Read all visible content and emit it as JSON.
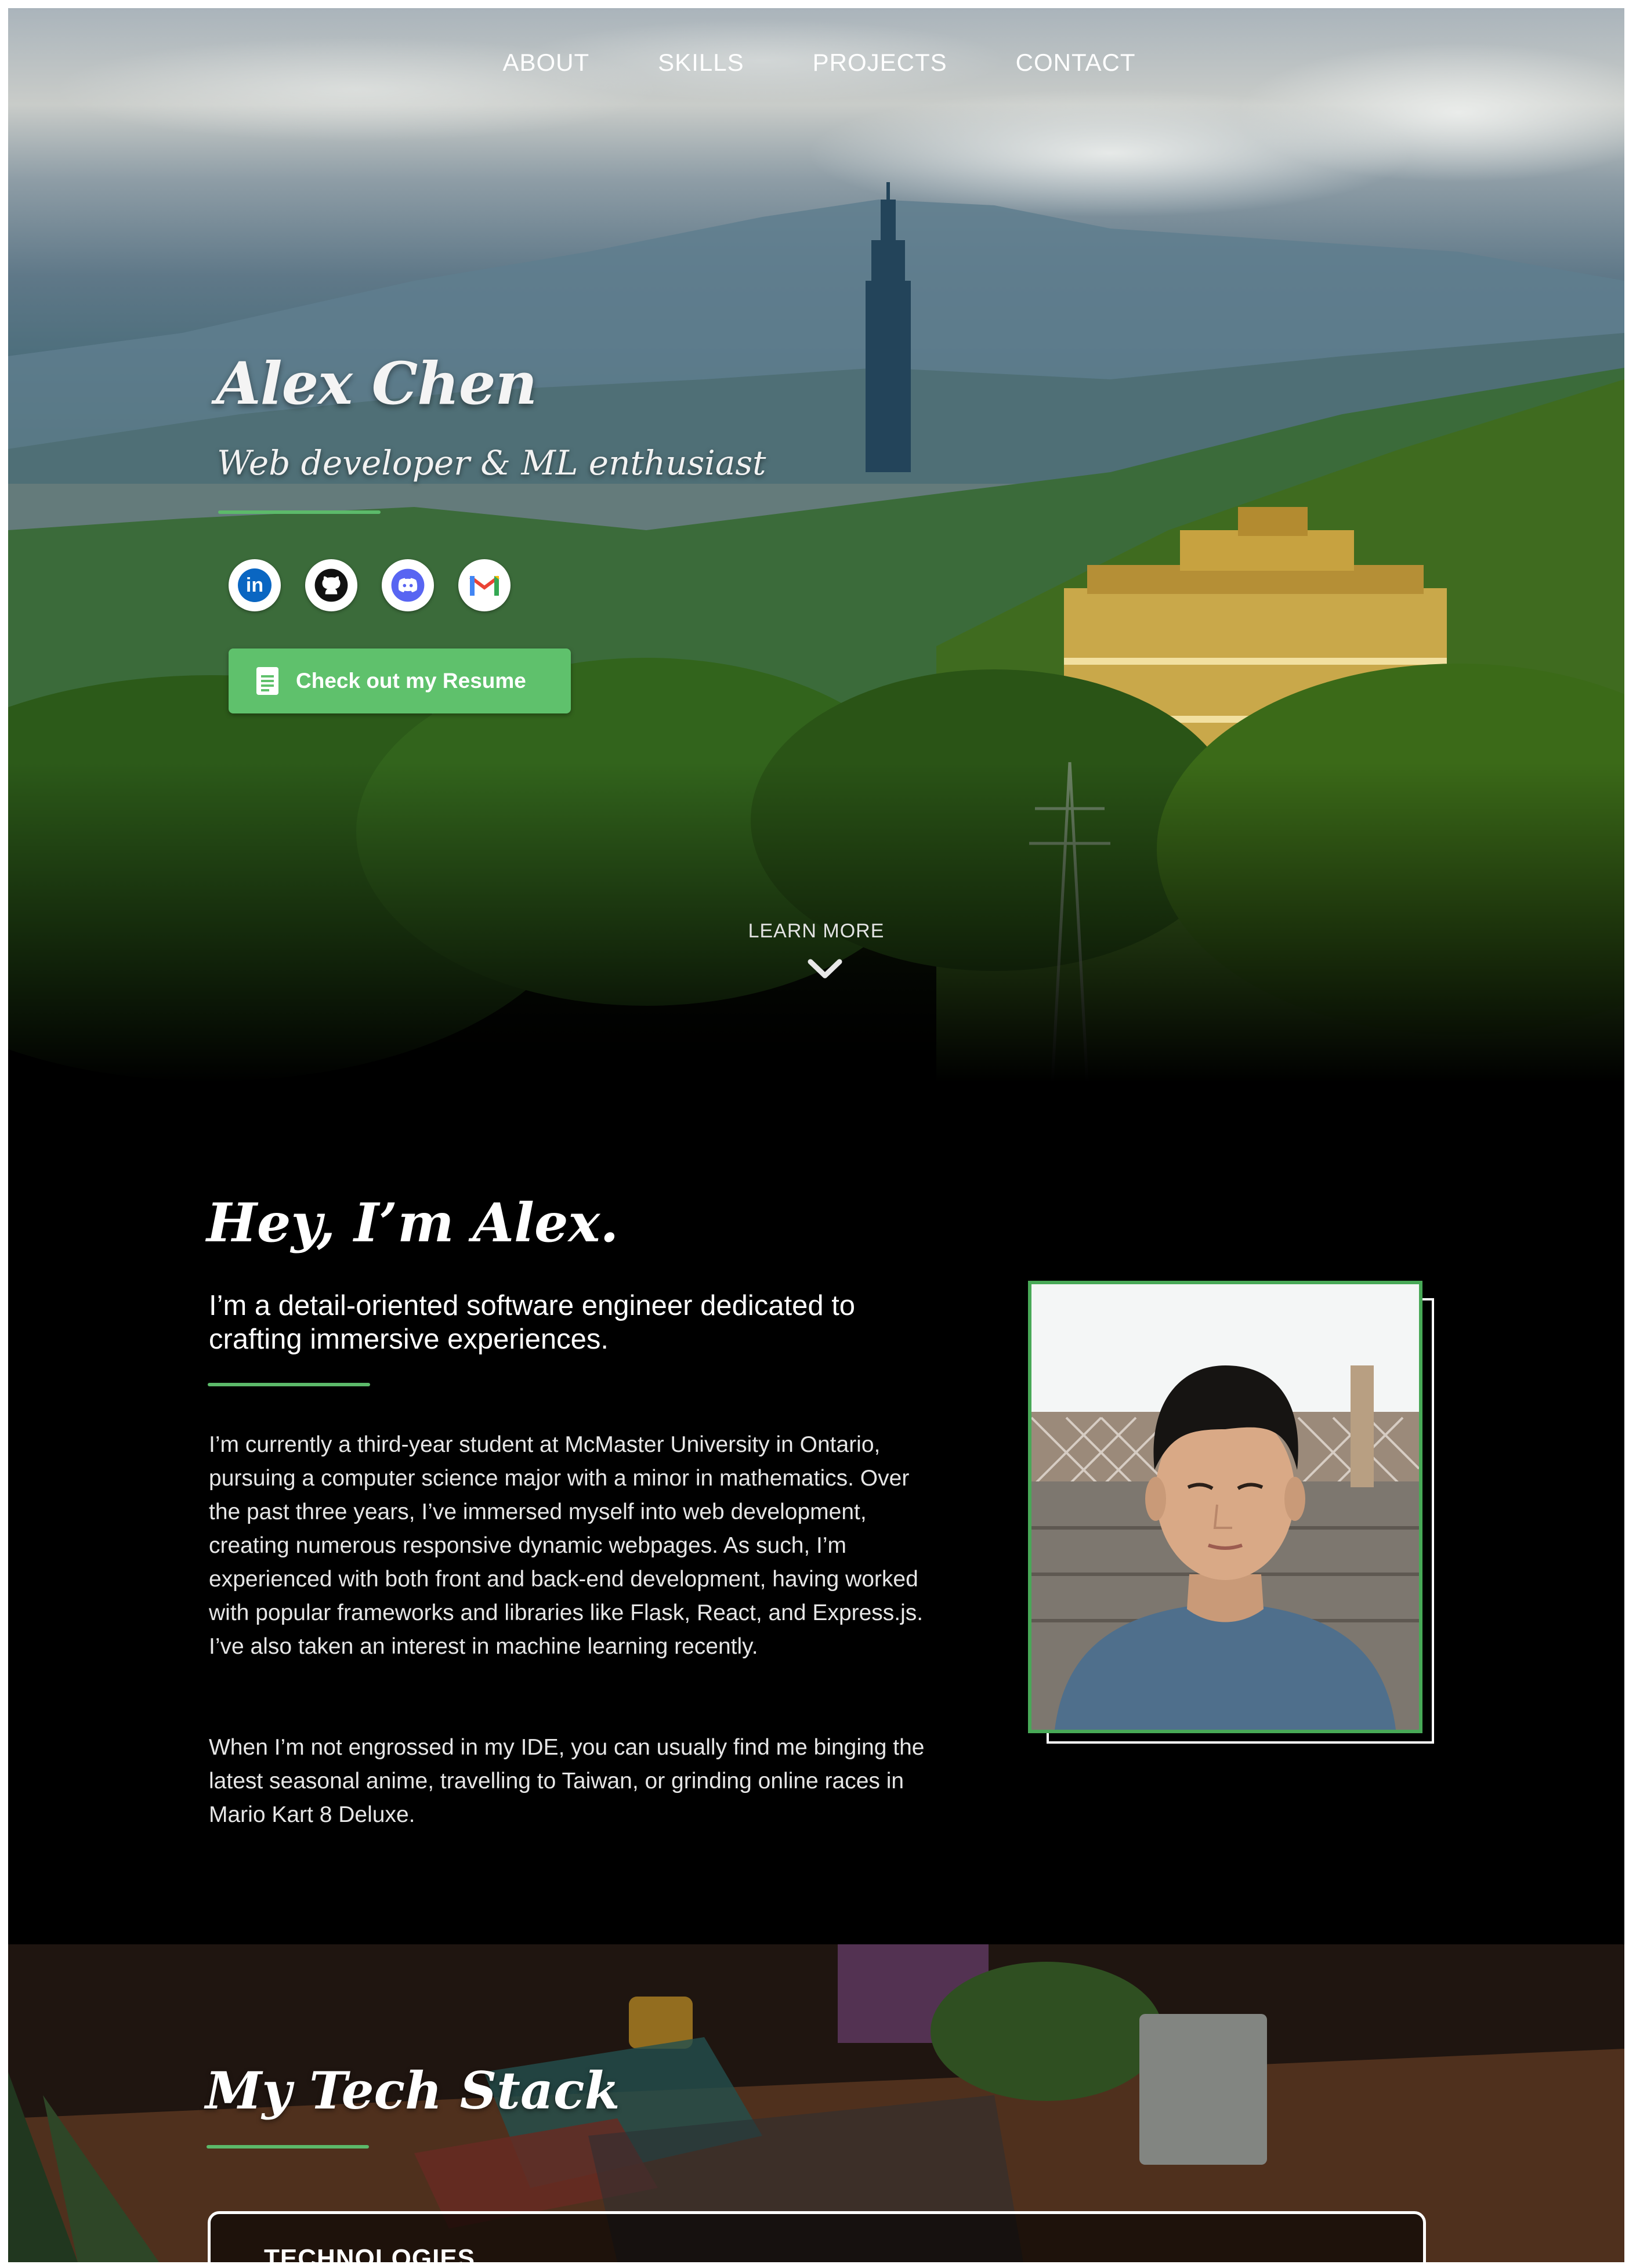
{
  "nav": {
    "items": [
      {
        "label": "ABOUT"
      },
      {
        "label": "SKILLS"
      },
      {
        "label": "PROJECTS"
      },
      {
        "label": "CONTACT"
      }
    ]
  },
  "hero": {
    "name": "Alex Chen",
    "tagline": "Web developer & ML enthusiast",
    "socials": [
      {
        "icon": "linkedin-icon",
        "glyph": "in",
        "color": "#0a66c2"
      },
      {
        "icon": "github-icon",
        "color": "#111111"
      },
      {
        "icon": "discord-icon",
        "color": "#5865f2"
      },
      {
        "icon": "gmail-icon",
        "glyph": "M",
        "color": "#ea4335"
      }
    ],
    "resume_button": "Check out my Resume",
    "learn_more": "LEARN MORE"
  },
  "about": {
    "title": "Hey, I’m Alex.",
    "lead": "I’m a detail-oriented software engineer dedicated to crafting immersive experiences.",
    "paragraph1": "I’m currently a third-year student at McMaster University in Ontario, pursuing a computer science major with a minor in mathematics. Over the past three years, I’ve immersed myself into web development, creating numerous responsive dynamic webpages. As such, I’m experienced with both front and back-end development, having worked with popular frameworks and libraries like Flask, React, and Express.js. I’ve also taken an interest in machine learning recently.",
    "paragraph2": "When I’m not engrossed in my IDE, you can usually find me binging the latest seasonal anime, travelling to Taiwan, or grinding online races in Mario Kart 8 Deluxe."
  },
  "stack": {
    "title": "My Tech Stack",
    "card_label": "TECHNOLOGIES"
  },
  "colors": {
    "accent": "#5cba6a",
    "resume_button": "#5fc16c",
    "photo_border": "#48a957"
  }
}
